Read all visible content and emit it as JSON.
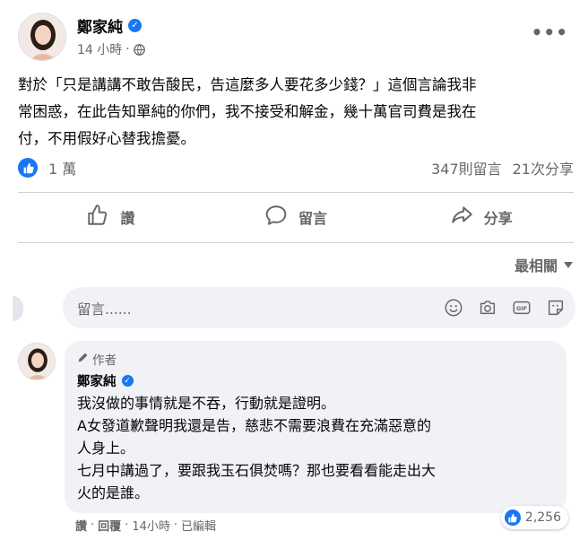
{
  "post": {
    "author": "鄭家純",
    "time": "14 小時",
    "separator": "·",
    "more": "•••",
    "text_lines": [
      "對於「只是講講不敢告酸民，告這麼多人要花多少錢？」這個言論我非",
      "常困惑，在此告知單純的你們，我不接受和解金，幾十萬官司費是我在",
      "付，不用假好心替我擔憂。"
    ],
    "likes": "1 萬",
    "comments_count": "347則留言",
    "shares_count": "21次分享"
  },
  "actions": {
    "like": "讚",
    "comment": "留言",
    "share": "分享"
  },
  "sort": {
    "label": "最相關"
  },
  "composer": {
    "placeholder": "留言......"
  },
  "comment": {
    "author_tag": "作者",
    "author": "鄭家純",
    "lines": [
      "我沒做的事情就是不吞，行動就是證明。",
      "A女發道歉聲明我還是告，慈悲不需要浪費在充滿惡意的",
      "人身上。",
      "七月中講過了，要跟我玉石俱焚嗎？那也要看看能走出大",
      "火的是誰。"
    ],
    "footer": {
      "like": "讚",
      "dot1": "·",
      "reply": "回覆",
      "dot2": "·",
      "time": "14小時",
      "dot3": "·",
      "edited": "已編輯"
    },
    "reactions": "2,256"
  },
  "colors": {
    "accent": "#1877f2",
    "secondary_text": "#65676b",
    "bubble_bg": "#f0f2f5"
  }
}
